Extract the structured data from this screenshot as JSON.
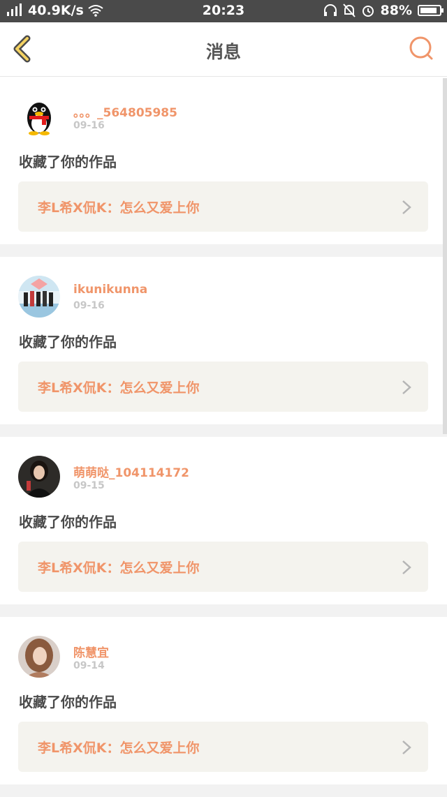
{
  "status_bar": {
    "network_type": "4G",
    "speed": "40.9K/s",
    "time": "20:23",
    "battery_percent": "88%",
    "battery_level": 0.88
  },
  "nav": {
    "title": "消息",
    "accent_color": "#f0956a",
    "back_icon": "chevron-left-icon",
    "search_icon": "search-icon"
  },
  "messages": [
    {
      "username": "。。。_564805985",
      "date": "09-16",
      "action": "收藏了你的作品",
      "work_title": "李L希X侃K：怎么又爱上你",
      "avatar_icon": "qq-penguin-avatar"
    },
    {
      "username": "ikunikunna",
      "date": "09-16",
      "action": "收藏了你的作品",
      "work_title": "李L希X侃K：怎么又爱上你",
      "avatar_icon": "group-photo-avatar"
    },
    {
      "username": "萌萌哒_104114172",
      "date": "09-15",
      "action": "收藏了你的作品",
      "work_title": "李L希X侃K：怎么又爱上你",
      "avatar_icon": "woman-photo-avatar"
    },
    {
      "username": "陈慧宜",
      "date": "09-14",
      "action": "收藏了你的作品",
      "work_title": "李L希X侃K：怎么又爱上你",
      "avatar_icon": "woman-portrait-avatar"
    }
  ]
}
